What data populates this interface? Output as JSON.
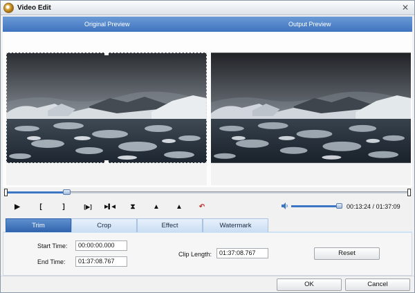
{
  "window": {
    "title": "Video Edit",
    "close_glyph": "✕"
  },
  "preview": {
    "original_label": "Original Preview",
    "output_label": "Output Preview"
  },
  "timeline": {
    "progress": 0.15
  },
  "controls": {
    "buttons": [
      {
        "name": "play-icon",
        "glyph": "▶"
      },
      {
        "name": "set-start-icon",
        "glyph": "["
      },
      {
        "name": "set-end-icon",
        "glyph": "]"
      },
      {
        "name": "play-selection-icon",
        "glyph": "[▶]"
      },
      {
        "name": "skip-next-icon",
        "glyph": "▶▌◀"
      },
      {
        "name": "trim-icon",
        "glyph": "⧗"
      },
      {
        "name": "mark-up-icon",
        "glyph": "▲"
      },
      {
        "name": "mark-down-icon",
        "glyph": "▲"
      },
      {
        "name": "undo-icon",
        "glyph": "↶"
      }
    ],
    "volume": 0.94,
    "time_current": "00:13:24",
    "time_total": "01:37:09",
    "time_separator": " / "
  },
  "tabs": [
    {
      "label": "Trim",
      "active": true
    },
    {
      "label": "Crop",
      "active": false
    },
    {
      "label": "Effect",
      "active": false
    },
    {
      "label": "Watermark",
      "active": false
    }
  ],
  "trim": {
    "start_label": "Start Time:",
    "start_value": "00:00:00.000",
    "end_label": "End Time:",
    "end_value": "01:37:08.767",
    "clip_length_label": "Clip Length:",
    "clip_length_value": "01:37:08.767",
    "reset_label": "Reset"
  },
  "footer": {
    "ok_label": "OK",
    "cancel_label": "Cancel"
  },
  "colors": {
    "accent": "#3f73bf",
    "header_blue": "#6b9bd6"
  }
}
